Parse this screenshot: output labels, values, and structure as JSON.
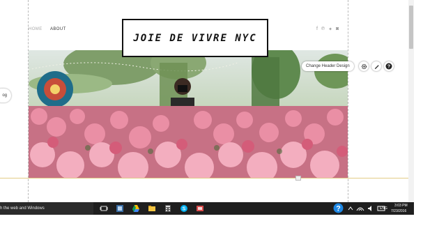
{
  "site": {
    "nav": {
      "home": "HOME",
      "about": "ABOUT"
    },
    "logo": "JOIE DE VIVRE NYC",
    "social_icons": [
      "facebook-icon",
      "pinterest-icon",
      "twitter-icon",
      "instagram-icon"
    ],
    "blog_tab": "og"
  },
  "editor": {
    "change_header_label": "Change Header Design",
    "tool_icons": [
      "gear-icon",
      "pen-icon",
      "help-icon"
    ]
  },
  "taskbar": {
    "search_text": "h the web and Windows",
    "apps": [
      "task-view-icon",
      "photo-app-icon",
      "google-drive-icon",
      "file-explorer-icon",
      "calculator-icon",
      "skype-icon",
      "photo-viewer-icon"
    ],
    "language": "ENG",
    "time": "3:03 PM",
    "date": "7/23/2016"
  },
  "colors": {
    "gold_line": "#e2cb85",
    "taskbar": "#1f1f1f",
    "help_blue": "#1e88e5",
    "skype_blue": "#00aff0"
  }
}
